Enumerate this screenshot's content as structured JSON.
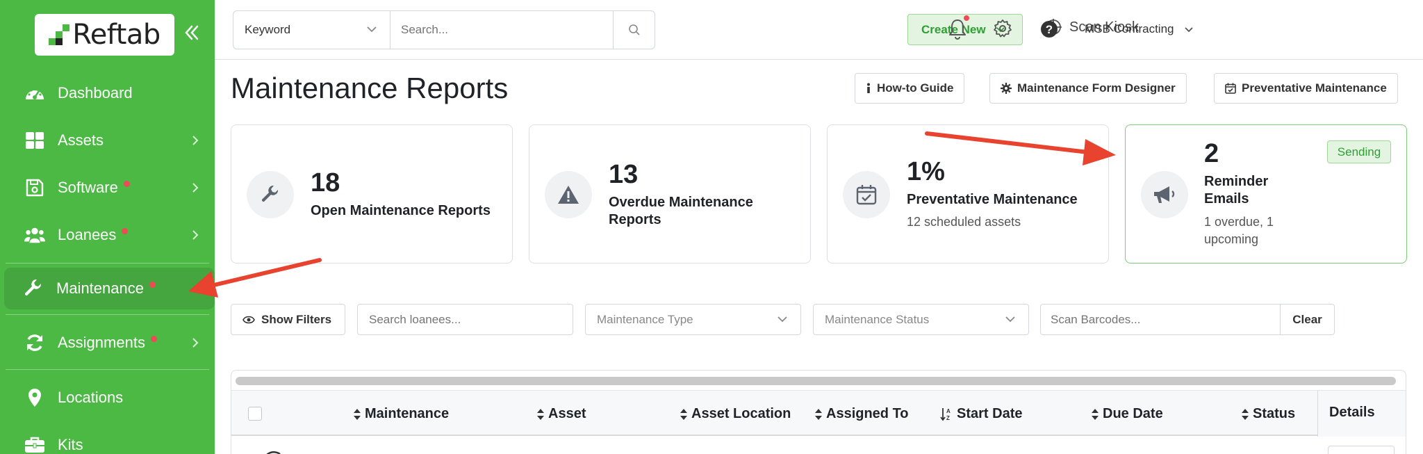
{
  "brand": {
    "name": "Reftab",
    "accent": "#4cb944",
    "accent_dark": "#2f9e34",
    "alert": "#ef4b57"
  },
  "sidebar": {
    "items": [
      {
        "label": "Dashboard",
        "icon": "dashboard-icon",
        "has_dot": false,
        "has_chevron": false
      },
      {
        "label": "Assets",
        "icon": "grid-icon",
        "has_dot": false,
        "has_chevron": true
      },
      {
        "label": "Software",
        "icon": "floppy-icon",
        "has_dot": true,
        "has_chevron": true
      },
      {
        "label": "Loanees",
        "icon": "users-icon",
        "has_dot": true,
        "has_chevron": true
      },
      {
        "label": "Maintenance",
        "icon": "wrench-icon",
        "has_dot": true,
        "has_chevron": false,
        "active": true
      },
      {
        "label": "Assignments",
        "icon": "sync-icon",
        "has_dot": true,
        "has_chevron": true
      },
      {
        "label": "Locations",
        "icon": "map-pin-icon",
        "has_dot": false,
        "has_chevron": false
      },
      {
        "label": "Kits",
        "icon": "briefcase-icon",
        "has_dot": false,
        "has_chevron": false
      }
    ]
  },
  "topbar": {
    "search_scope": "Keyword",
    "search_placeholder": "Search...",
    "create_new": "Create New",
    "scan_kiosk": "Scan Kiosk",
    "org_name": "MSB Contracting"
  },
  "page": {
    "title": "Maintenance Reports",
    "buttons": {
      "how_to": "How-to Guide",
      "form_designer": "Maintenance Form Designer",
      "preventative": "Preventative Maintenance"
    }
  },
  "cards": [
    {
      "number": "18",
      "label": "Open Maintenance Reports",
      "sub": ""
    },
    {
      "number": "13",
      "label": "Overdue Maintenance Reports",
      "sub": ""
    },
    {
      "number": "1%",
      "label": "Preventative Maintenance",
      "sub": "12 scheduled assets"
    },
    {
      "number": "2",
      "label": "Reminder Emails",
      "sub": "1 overdue, 1 upcoming",
      "badge": "Sending"
    }
  ],
  "filters": {
    "show_filters": "Show Filters",
    "loanee_placeholder": "Search loanees...",
    "type_placeholder": "Maintenance Type",
    "status_placeholder": "Maintenance Status",
    "barcode_placeholder": "Scan Barcodes...",
    "clear": "Clear"
  },
  "table": {
    "columns": [
      "Maintenance",
      "Asset",
      "Asset Location",
      "Assigned To",
      "Start Date",
      "Due Date",
      "Status"
    ],
    "details": "Details"
  }
}
